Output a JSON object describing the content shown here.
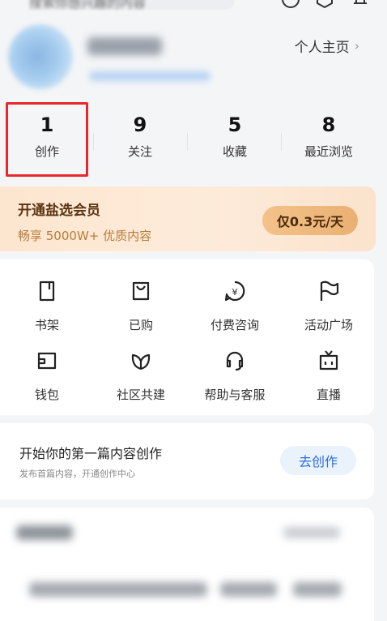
{
  "topbar": {
    "search_placeholder": "搜索你感兴趣的内容"
  },
  "profile": {
    "home_link": "个人主页",
    "chevron": "›"
  },
  "stats": [
    {
      "value": "1",
      "label": "创作"
    },
    {
      "value": "9",
      "label": "关注"
    },
    {
      "value": "5",
      "label": "收藏"
    },
    {
      "value": "8",
      "label": "最近浏览"
    }
  ],
  "vip": {
    "title": "开通盐选会员",
    "subtitle": "畅享 5000W+ 优质内容",
    "button": "仅0.3元/天"
  },
  "grid": [
    {
      "label": "书架",
      "icon": "bookshelf-icon"
    },
    {
      "label": "已购",
      "icon": "shopping-bag-icon"
    },
    {
      "label": "付费咨询",
      "icon": "paid-consult-icon"
    },
    {
      "label": "活动广场",
      "icon": "flag-icon"
    },
    {
      "label": "钱包",
      "icon": "wallet-icon"
    },
    {
      "label": "社区共建",
      "icon": "community-icon"
    },
    {
      "label": "帮助与客服",
      "icon": "headset-icon"
    },
    {
      "label": "直播",
      "icon": "live-tv-icon"
    }
  ],
  "create": {
    "title": "开始你的第一篇内容创作",
    "subtitle": "发布首篇内容，开通创作中心",
    "button": "去创作"
  }
}
